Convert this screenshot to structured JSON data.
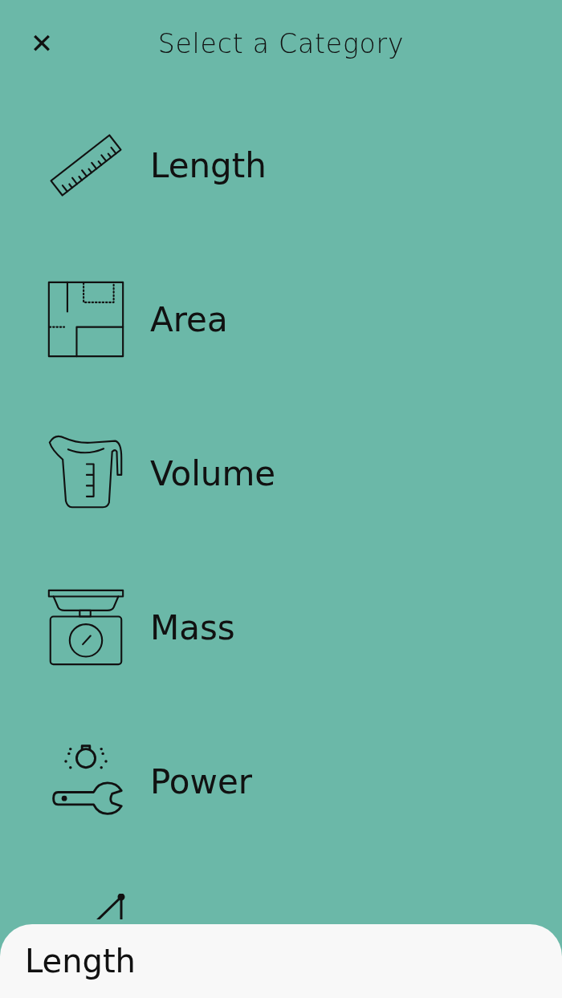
{
  "header": {
    "close": "✕",
    "title": "Select a Category"
  },
  "categories": [
    {
      "kind": "length",
      "label": "Length"
    },
    {
      "kind": "area",
      "label": "Area"
    },
    {
      "kind": "volume",
      "label": "Volume"
    },
    {
      "kind": "mass",
      "label": "Mass"
    },
    {
      "kind": "power",
      "label": "Power"
    },
    {
      "kind": "angle"
    }
  ],
  "bottom_sheet": {
    "value": "Length"
  }
}
